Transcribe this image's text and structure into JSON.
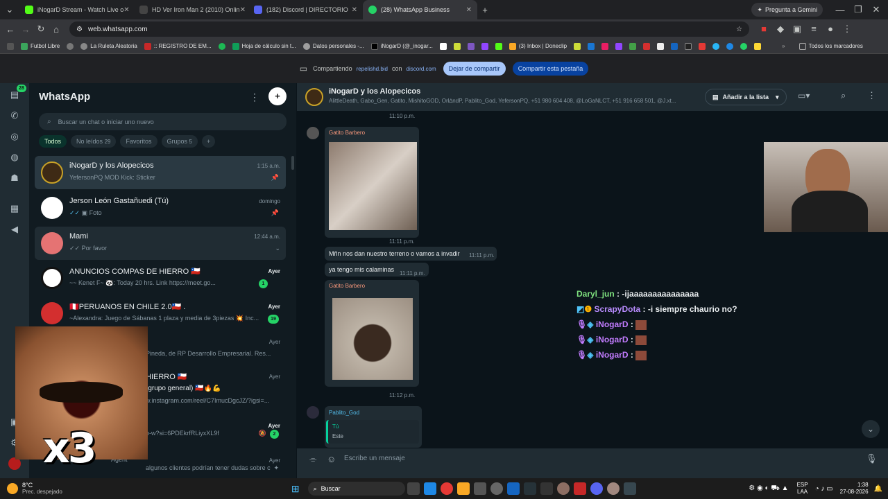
{
  "browser": {
    "tabs": [
      {
        "label": "iNogarD Stream - Watch Live o",
        "color": "#53fc18"
      },
      {
        "label": "HD Ver Iron Man 2 (2010) Onlin",
        "color": "#222"
      },
      {
        "label": "(182) Discord | DIRECTORIO",
        "color": "#5865f2"
      },
      {
        "label": "(28) WhatsApp Business",
        "color": "#25d366"
      }
    ],
    "gemini": "Pregunta a Gemini",
    "url": "web.whatsapp.com",
    "bookmarks": [
      "Futbol Libre",
      "La Ruleta Aleatoria",
      ":: REGISTRO DE EM...",
      "Hoja de cálculo sin t...",
      "Datos personales -...",
      "iNogarD (@_inogar...",
      "(3) Inbox | Doneclip"
    ],
    "bookmarks_folder": "Todos los marcadores"
  },
  "share": {
    "sharing": "Compartiendo",
    "site": "repelishd.bid",
    "with": "con",
    "target": "discord.com",
    "stop": "Dejar de compartir",
    "share_tab": "Compartir esta pestaña"
  },
  "rail": {
    "unread": "28"
  },
  "sidebar": {
    "title": "WhatsApp",
    "search_placeholder": "Buscar un chat o iniciar uno nuevo",
    "filters": [
      {
        "label": "Todos"
      },
      {
        "label": "No leídos",
        "count": "29"
      },
      {
        "label": "Favoritos"
      },
      {
        "label": "Grupos",
        "count": "5"
      }
    ],
    "chats": [
      {
        "name": "iNogarD y los Alopecicos",
        "preview": "YefersonPQ MOD Kick: Sticker",
        "time": "1:15 a.m."
      },
      {
        "name": "Jerson León Gastañuedi (Tú)",
        "preview": "Foto",
        "time": "domingo"
      },
      {
        "name": "Mami",
        "preview": "Por favor",
        "time": "12:44 a.m."
      },
      {
        "name": "ANUNCIOS COMPAS DE HIERRO 🇨🇱",
        "preview": "~~ Kenet F~ 🐼: Today 20 hrs. Link https://meet.go...",
        "time": "Ayer",
        "badge": "1"
      },
      {
        "name": "🇵🇪PERUANOS EN CHILE 2.0🇨🇱 .",
        "preview": "~Alexandra: Juego de Sábanas 1 plaza y media de 3piezas 💥 Inc...",
        "time": "Ayer",
        "badge": "19"
      },
      {
        "name": "",
        "preview": "Pineda, de RP Desarrollo Empresarial. Res...",
        "time": "Ayer"
      },
      {
        "name": "HIERRO 🇨🇱",
        "preview": "(grupo general) 🇨🇱🔥💪",
        "preview2": "w.instagram.com/reel/C7ImucDgcJZ/?igsi=...",
        "time": "Ayer"
      },
      {
        "name": "",
        "preview": "o-w?si=6PDEkrfRLiyxXL9f",
        "time": "Ayer",
        "badge": "2"
      },
      {
        "name": "Agent",
        "preview": "algunos clientes podrían tener dudas sobre cómo r...",
        "time": "Ayer"
      }
    ]
  },
  "chat": {
    "name": "iNogarD y los Alopecicos",
    "members": "AlittleDeath, Gabo_Gen, Gatito, MishitoGOD, Orl∆ndP, Pablito_God, YefersonPQ, +51 980 604 408, @LoGaNLCT, +51 916 658 501, @J.xt...",
    "add_list": "Añadir a la lista",
    "messages": {
      "t0": "11:10 p.m.",
      "sender1": "Gatito Barbero",
      "t1": "11:11 p.m.",
      "text1": "Mñn nos dan nuestro terreno o vamos a invadir",
      "t2": "11:11 p.m.",
      "text2": "ya tengo mis calaminas",
      "t3": "11:11 p.m.",
      "sender2": "Gatito Barbero",
      "t4": "11:12 p.m.",
      "sender3": "Pablito_God",
      "quote_author": "Tú",
      "quote_text": "Este"
    },
    "composer_placeholder": "Escribe un mensaje"
  },
  "overlay": {
    "lines": [
      {
        "user": "Daryl_jun",
        "text": ": -ijaaaaaaaaaaaaaaa",
        "color": "#7ee07e"
      },
      {
        "user": "ScrapyDota",
        "text": ": -i siempre chaurio no?",
        "color": "#b98cff"
      },
      {
        "user": "iNogarD",
        "text": ":",
        "color": "#c27cff"
      },
      {
        "user": "iNogarD",
        "text": ":",
        "color": "#c27cff"
      },
      {
        "user": "iNogarD",
        "text": ":",
        "color": "#c27cff"
      }
    ],
    "emote_text": "x3"
  },
  "taskbar": {
    "temp": "8°C",
    "weather": "Prec. despejado",
    "search": "Buscar",
    "lang": "ESP",
    "lang2": "LAA",
    "time": "1:38",
    "date": "27-08-2026"
  }
}
